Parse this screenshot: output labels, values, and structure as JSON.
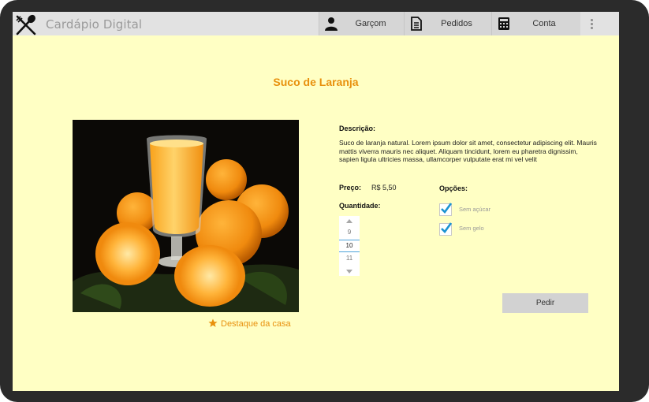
{
  "header": {
    "app_title": "Cardápio Digital",
    "logo_icon": "fork-spoon-icon",
    "nav": [
      {
        "label": "Garçom",
        "icon": "person-icon"
      },
      {
        "label": "Pedidos",
        "icon": "document-icon"
      },
      {
        "label": "Conta",
        "icon": "calculator-icon"
      }
    ],
    "menu_icon": "more-vertical-icon"
  },
  "item": {
    "title": "Suco de Laranja",
    "image_subject": "orange-juice-photo",
    "highlight_label": "Destaque da casa",
    "description_label": "Descrição:",
    "description": "Suco de laranja natural. Lorem ipsum dolor sit amet, consectetur adipiscing elit. Mauris mattis viverra mauris nec aliquet. Aliquam tincidunt, lorem eu pharetra dignissim, sapien ligula ultricies massa, ullamcorper vulputate erat mi vel velit",
    "price_label": "Preço:",
    "price": "R$ 5,50",
    "quantity_label": "Quantidade:",
    "quantity_options": [
      "9",
      "10",
      "11"
    ],
    "quantity_selected": "10",
    "options_label": "Opções:",
    "options": [
      {
        "label": "Sem açúcar",
        "checked": true
      },
      {
        "label": "Sem gelo",
        "checked": true
      }
    ],
    "order_button": "Pedir"
  },
  "colors": {
    "background": "#ffffc4",
    "accent": "#e8900c",
    "check": "#1b93d1"
  }
}
